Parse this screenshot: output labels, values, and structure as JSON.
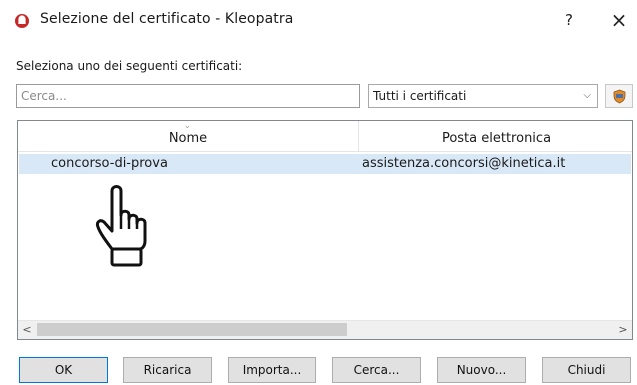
{
  "window": {
    "title": "Selezione del certificato - Kleopatra",
    "help_glyph": "?",
    "close_glyph": "×",
    "app_icon": "kleopatra-icon"
  },
  "prompt": "Seleziona uno dei seguenti certificati:",
  "search": {
    "placeholder": "Cerca...",
    "value": ""
  },
  "filter": {
    "selected": "Tutti i certificati",
    "arrow": "⌵"
  },
  "details_button_icon": "certificate-details-icon",
  "table": {
    "columns": [
      "Nome",
      "Posta elettronica"
    ],
    "sort_indicator": "⌄",
    "rows": [
      {
        "name": "concorso-di-prova",
        "email": "assistenza.concorsi@kinetica.it",
        "selected": true
      }
    ],
    "scroll_left": "<",
    "scroll_right": ">"
  },
  "pointer_icon": "hand-pointer-icon",
  "buttons": {
    "ok": "OK",
    "reload": "Ricarica",
    "import": "Importa...",
    "search": "Cerca...",
    "new": "Nuovo...",
    "close": "Chiudi"
  },
  "colors": {
    "accent": "#0078d7",
    "selection": "#d9e8f7",
    "icon_red": "#c62828"
  }
}
